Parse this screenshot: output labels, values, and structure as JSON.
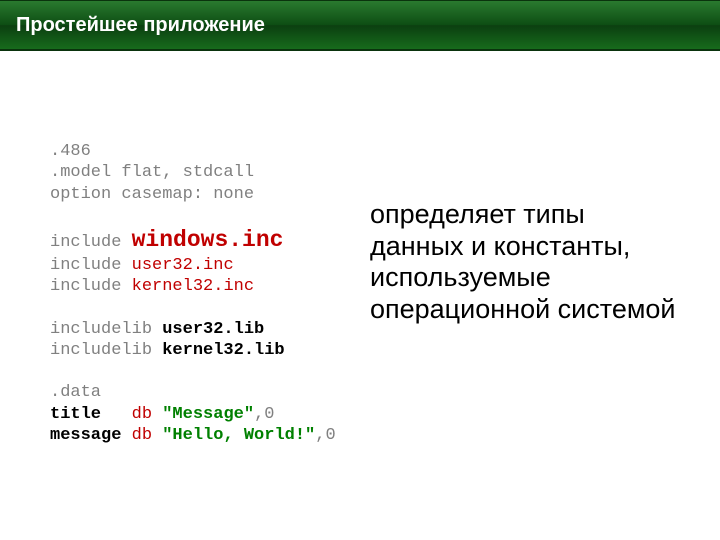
{
  "title": "Простейшее приложение",
  "code": {
    "l1": ".486",
    "l2": ".model flat, stdcall",
    "l3": "option casemap: none",
    "l4a": "include ",
    "l4b": "windows.inc",
    "l5a": "include ",
    "l5b": "user32.inc",
    "l6a": "include ",
    "l6b": "kernel32.inc",
    "l7a": "includelib ",
    "l7b": "user32.lib",
    "l8a": "includelib ",
    "l8b": "kernel32.lib",
    "l9": ".data",
    "l10a": "title   ",
    "l10b": "db ",
    "l10c": "\"Message\"",
    "l10d": ",0",
    "l11a": "message ",
    "l11b": "db ",
    "l11c": "\"Hello, World!\"",
    "l11d": ",0"
  },
  "description": "определяет типы данных и константы, используемые операционной системой"
}
